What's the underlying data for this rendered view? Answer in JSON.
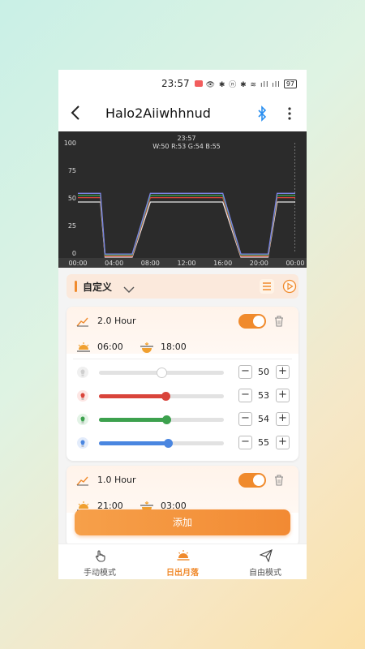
{
  "status_bar": {
    "time": "23:57",
    "icons": "👁 ✱ ⓝ ✱ ≋ ıll ıll",
    "battery": "97"
  },
  "header": {
    "title": "Halo2Aiiwhhnud"
  },
  "chart_data": {
    "type": "line",
    "cursor": {
      "time": "23:57",
      "readout": "W:50 R:53 G:54 B:55"
    },
    "x_ticks": [
      "00:00",
      "04:00",
      "08:00",
      "12:00",
      "16:00",
      "20:00",
      "00:00"
    ],
    "y_ticks": [
      "100",
      "75",
      "50",
      "25",
      "0"
    ],
    "ylim": [
      0,
      100
    ],
    "xlim_hours": [
      0,
      24
    ],
    "series": [
      {
        "name": "W",
        "color": "#e8e8e8",
        "points": [
          [
            0,
            50
          ],
          [
            2.5,
            50
          ],
          [
            3,
            0
          ],
          [
            6,
            0
          ],
          [
            8,
            50
          ],
          [
            16,
            50
          ],
          [
            18,
            0
          ],
          [
            21,
            0
          ],
          [
            22,
            50
          ],
          [
            24,
            50
          ]
        ]
      },
      {
        "name": "R",
        "color": "#d9443b",
        "points": [
          [
            0,
            53
          ],
          [
            2.5,
            53
          ],
          [
            3,
            0
          ],
          [
            6,
            0
          ],
          [
            8,
            53
          ],
          [
            16,
            53
          ],
          [
            18,
            0
          ],
          [
            21,
            0
          ],
          [
            22,
            53
          ],
          [
            24,
            53
          ]
        ]
      },
      {
        "name": "G",
        "color": "#3da14e",
        "points": [
          [
            0,
            54
          ],
          [
            2.5,
            54
          ],
          [
            3,
            0
          ],
          [
            6,
            0
          ],
          [
            8,
            54
          ],
          [
            16,
            54
          ],
          [
            18,
            0
          ],
          [
            21,
            0
          ],
          [
            22,
            54
          ],
          [
            24,
            54
          ]
        ]
      },
      {
        "name": "B",
        "color": "#7c83e6",
        "points": [
          [
            0,
            55
          ],
          [
            2.5,
            55
          ],
          [
            3,
            0
          ],
          [
            6,
            0
          ],
          [
            8,
            55
          ],
          [
            16,
            55
          ],
          [
            18,
            0
          ],
          [
            21,
            0
          ],
          [
            22,
            55
          ],
          [
            24,
            55
          ]
        ]
      }
    ]
  },
  "mode": {
    "label": "自定义"
  },
  "card1": {
    "hour": "2.0 Hour",
    "sunrise": "06:00",
    "sunset": "18:00",
    "channels": [
      {
        "value": 50,
        "color": "#dddddd"
      },
      {
        "value": 53,
        "color": "#d9443b"
      },
      {
        "value": 54,
        "color": "#3da14e"
      },
      {
        "value": 55,
        "color": "#4a86e0"
      }
    ]
  },
  "card2": {
    "hour": "1.0 Hour",
    "sunrise": "21:00",
    "sunset": "03:00"
  },
  "add_button": "添加",
  "tabs": [
    {
      "label": "手动模式"
    },
    {
      "label": "日出月落"
    },
    {
      "label": "自由模式"
    }
  ],
  "accent_color": "#f08a2c",
  "icons": [
    "back-arrow-icon",
    "bluetooth-icon",
    "more-vertical-icon",
    "chevron-down-icon",
    "list-icon",
    "play-icon",
    "ramp-hour-icon",
    "trash-icon",
    "sunrise-icon",
    "sunset-icon",
    "bulb-icon",
    "hand-icon",
    "sunrise-tab-icon",
    "send-icon"
  ]
}
